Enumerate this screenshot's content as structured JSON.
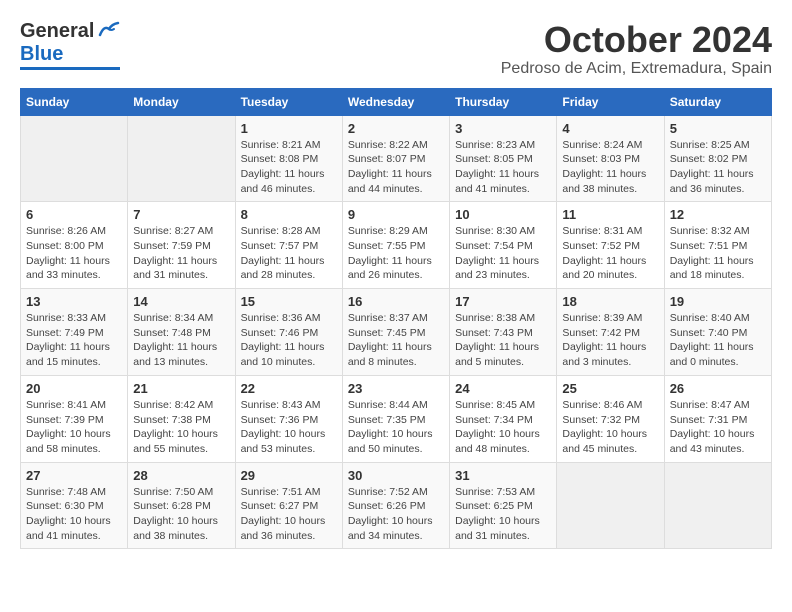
{
  "header": {
    "logo_general": "General",
    "logo_blue": "Blue",
    "month_title": "October 2024",
    "location": "Pedroso de Acim, Extremadura, Spain"
  },
  "weekdays": [
    "Sunday",
    "Monday",
    "Tuesday",
    "Wednesday",
    "Thursday",
    "Friday",
    "Saturday"
  ],
  "weeks": [
    [
      {
        "day": "",
        "info": ""
      },
      {
        "day": "",
        "info": ""
      },
      {
        "day": "1",
        "sunrise": "Sunrise: 8:21 AM",
        "sunset": "Sunset: 8:08 PM",
        "daylight": "Daylight: 11 hours and 46 minutes."
      },
      {
        "day": "2",
        "sunrise": "Sunrise: 8:22 AM",
        "sunset": "Sunset: 8:07 PM",
        "daylight": "Daylight: 11 hours and 44 minutes."
      },
      {
        "day": "3",
        "sunrise": "Sunrise: 8:23 AM",
        "sunset": "Sunset: 8:05 PM",
        "daylight": "Daylight: 11 hours and 41 minutes."
      },
      {
        "day": "4",
        "sunrise": "Sunrise: 8:24 AM",
        "sunset": "Sunset: 8:03 PM",
        "daylight": "Daylight: 11 hours and 38 minutes."
      },
      {
        "day": "5",
        "sunrise": "Sunrise: 8:25 AM",
        "sunset": "Sunset: 8:02 PM",
        "daylight": "Daylight: 11 hours and 36 minutes."
      }
    ],
    [
      {
        "day": "6",
        "sunrise": "Sunrise: 8:26 AM",
        "sunset": "Sunset: 8:00 PM",
        "daylight": "Daylight: 11 hours and 33 minutes."
      },
      {
        "day": "7",
        "sunrise": "Sunrise: 8:27 AM",
        "sunset": "Sunset: 7:59 PM",
        "daylight": "Daylight: 11 hours and 31 minutes."
      },
      {
        "day": "8",
        "sunrise": "Sunrise: 8:28 AM",
        "sunset": "Sunset: 7:57 PM",
        "daylight": "Daylight: 11 hours and 28 minutes."
      },
      {
        "day": "9",
        "sunrise": "Sunrise: 8:29 AM",
        "sunset": "Sunset: 7:55 PM",
        "daylight": "Daylight: 11 hours and 26 minutes."
      },
      {
        "day": "10",
        "sunrise": "Sunrise: 8:30 AM",
        "sunset": "Sunset: 7:54 PM",
        "daylight": "Daylight: 11 hours and 23 minutes."
      },
      {
        "day": "11",
        "sunrise": "Sunrise: 8:31 AM",
        "sunset": "Sunset: 7:52 PM",
        "daylight": "Daylight: 11 hours and 20 minutes."
      },
      {
        "day": "12",
        "sunrise": "Sunrise: 8:32 AM",
        "sunset": "Sunset: 7:51 PM",
        "daylight": "Daylight: 11 hours and 18 minutes."
      }
    ],
    [
      {
        "day": "13",
        "sunrise": "Sunrise: 8:33 AM",
        "sunset": "Sunset: 7:49 PM",
        "daylight": "Daylight: 11 hours and 15 minutes."
      },
      {
        "day": "14",
        "sunrise": "Sunrise: 8:34 AM",
        "sunset": "Sunset: 7:48 PM",
        "daylight": "Daylight: 11 hours and 13 minutes."
      },
      {
        "day": "15",
        "sunrise": "Sunrise: 8:36 AM",
        "sunset": "Sunset: 7:46 PM",
        "daylight": "Daylight: 11 hours and 10 minutes."
      },
      {
        "day": "16",
        "sunrise": "Sunrise: 8:37 AM",
        "sunset": "Sunset: 7:45 PM",
        "daylight": "Daylight: 11 hours and 8 minutes."
      },
      {
        "day": "17",
        "sunrise": "Sunrise: 8:38 AM",
        "sunset": "Sunset: 7:43 PM",
        "daylight": "Daylight: 11 hours and 5 minutes."
      },
      {
        "day": "18",
        "sunrise": "Sunrise: 8:39 AM",
        "sunset": "Sunset: 7:42 PM",
        "daylight": "Daylight: 11 hours and 3 minutes."
      },
      {
        "day": "19",
        "sunrise": "Sunrise: 8:40 AM",
        "sunset": "Sunset: 7:40 PM",
        "daylight": "Daylight: 11 hours and 0 minutes."
      }
    ],
    [
      {
        "day": "20",
        "sunrise": "Sunrise: 8:41 AM",
        "sunset": "Sunset: 7:39 PM",
        "daylight": "Daylight: 10 hours and 58 minutes."
      },
      {
        "day": "21",
        "sunrise": "Sunrise: 8:42 AM",
        "sunset": "Sunset: 7:38 PM",
        "daylight": "Daylight: 10 hours and 55 minutes."
      },
      {
        "day": "22",
        "sunrise": "Sunrise: 8:43 AM",
        "sunset": "Sunset: 7:36 PM",
        "daylight": "Daylight: 10 hours and 53 minutes."
      },
      {
        "day": "23",
        "sunrise": "Sunrise: 8:44 AM",
        "sunset": "Sunset: 7:35 PM",
        "daylight": "Daylight: 10 hours and 50 minutes."
      },
      {
        "day": "24",
        "sunrise": "Sunrise: 8:45 AM",
        "sunset": "Sunset: 7:34 PM",
        "daylight": "Daylight: 10 hours and 48 minutes."
      },
      {
        "day": "25",
        "sunrise": "Sunrise: 8:46 AM",
        "sunset": "Sunset: 7:32 PM",
        "daylight": "Daylight: 10 hours and 45 minutes."
      },
      {
        "day": "26",
        "sunrise": "Sunrise: 8:47 AM",
        "sunset": "Sunset: 7:31 PM",
        "daylight": "Daylight: 10 hours and 43 minutes."
      }
    ],
    [
      {
        "day": "27",
        "sunrise": "Sunrise: 7:48 AM",
        "sunset": "Sunset: 6:30 PM",
        "daylight": "Daylight: 10 hours and 41 minutes."
      },
      {
        "day": "28",
        "sunrise": "Sunrise: 7:50 AM",
        "sunset": "Sunset: 6:28 PM",
        "daylight": "Daylight: 10 hours and 38 minutes."
      },
      {
        "day": "29",
        "sunrise": "Sunrise: 7:51 AM",
        "sunset": "Sunset: 6:27 PM",
        "daylight": "Daylight: 10 hours and 36 minutes."
      },
      {
        "day": "30",
        "sunrise": "Sunrise: 7:52 AM",
        "sunset": "Sunset: 6:26 PM",
        "daylight": "Daylight: 10 hours and 34 minutes."
      },
      {
        "day": "31",
        "sunrise": "Sunrise: 7:53 AM",
        "sunset": "Sunset: 6:25 PM",
        "daylight": "Daylight: 10 hours and 31 minutes."
      },
      {
        "day": "",
        "info": ""
      },
      {
        "day": "",
        "info": ""
      }
    ]
  ]
}
